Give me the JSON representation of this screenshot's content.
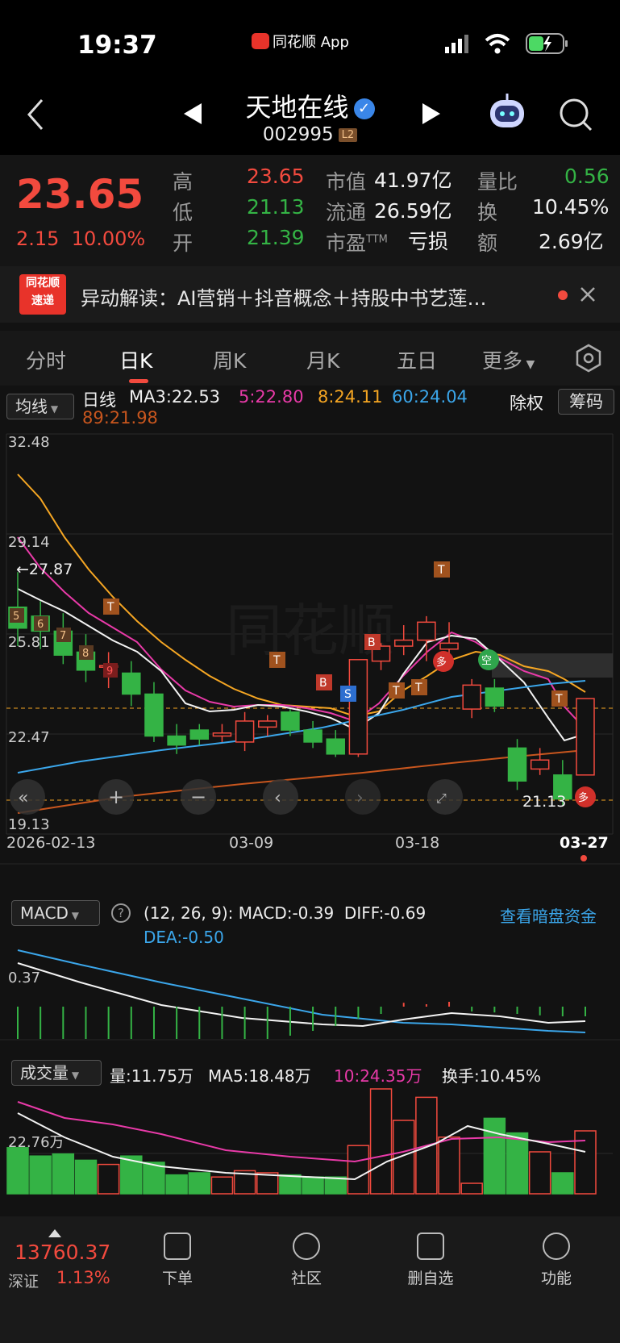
{
  "status": {
    "time": "19:37",
    "app": "同花顺 App"
  },
  "nav": {
    "name": "天地在线",
    "verified": "✓",
    "code": "002995",
    "level": "L2"
  },
  "quote": {
    "price": "23.65",
    "change": "2.15",
    "pct": "10.00%",
    "high_label": "高",
    "high": "23.65",
    "low_label": "低",
    "low": "21.13",
    "open_label": "开",
    "open": "21.39",
    "mcap_label": "市值",
    "mcap": "41.97亿",
    "float_label": "流通",
    "float": "26.59亿",
    "pe_label": "市盈",
    "pe_sup": "TTM",
    "pe": "亏损",
    "vr_label": "量比",
    "vr": "0.56",
    "turn_label": "换",
    "turn": "10.45%",
    "amt_label": "额",
    "amt": "2.69亿"
  },
  "news": {
    "logo_top": "同花顺",
    "logo_bottom": "速递",
    "text": "异动解读：AI营销＋抖音概念＋持股中书艺莲…"
  },
  "tabs": [
    "分时",
    "日K",
    "周K",
    "月K",
    "五日",
    "更多"
  ],
  "kline": {
    "indicator_btn": "均线",
    "ma_title": "日线",
    "ma3": "MA3:22.53",
    "ma5": "5:22.80",
    "ma8": "8:24.11",
    "ma60": "60:24.04",
    "ma89": "89:21.98",
    "fq_btn": "除权",
    "chip_btn": "筹码",
    "y_labels": [
      "32.48",
      "29.14",
      "25.81",
      "22.47",
      "19.13"
    ],
    "max_mark": "←27.87",
    "min_mark": "21.13",
    "dates": [
      "2026-02-13",
      "03-09",
      "03-18",
      "03-27"
    ],
    "duo": "多",
    "kong": "空"
  },
  "chart_data": {
    "type": "candlestick",
    "ylim": [
      19.13,
      32.48
    ],
    "candles": [
      {
        "o": 26.7,
        "c": 26.0,
        "h": 27.87,
        "l": 25.4
      },
      {
        "o": 26.4,
        "c": 25.9,
        "h": 26.9,
        "l": 25.3
      },
      {
        "o": 25.9,
        "c": 25.1,
        "h": 26.5,
        "l": 24.8
      },
      {
        "o": 25.2,
        "c": 24.6,
        "h": 25.8,
        "l": 24.2
      },
      {
        "o": 24.7,
        "c": 24.75,
        "h": 25.2,
        "l": 24.0
      },
      {
        "o": 24.5,
        "c": 23.8,
        "h": 24.9,
        "l": 23.4
      },
      {
        "o": 23.8,
        "c": 22.4,
        "h": 24.2,
        "l": 22.2
      },
      {
        "o": 22.4,
        "c": 22.1,
        "h": 22.8,
        "l": 21.8
      },
      {
        "o": 22.6,
        "c": 22.3,
        "h": 22.8,
        "l": 22.1
      },
      {
        "o": 22.4,
        "c": 22.5,
        "h": 22.8,
        "l": 22.2
      },
      {
        "o": 22.2,
        "c": 22.9,
        "h": 23.2,
        "l": 21.9
      },
      {
        "o": 22.7,
        "c": 22.9,
        "h": 23.1,
        "l": 22.4
      },
      {
        "o": 23.2,
        "c": 22.6,
        "h": 23.3,
        "l": 22.4
      },
      {
        "o": 22.6,
        "c": 22.2,
        "h": 22.9,
        "l": 22.0
      },
      {
        "o": 22.3,
        "c": 21.8,
        "h": 22.6,
        "l": 21.7
      },
      {
        "o": 21.8,
        "c": 24.95,
        "h": 24.95,
        "l": 21.7
      },
      {
        "o": 24.9,
        "c": 25.4,
        "h": 25.5,
        "l": 24.6
      },
      {
        "o": 25.4,
        "c": 25.6,
        "h": 26.1,
        "l": 25.1
      },
      {
        "o": 25.6,
        "c": 26.2,
        "h": 26.4,
        "l": 24.9
      },
      {
        "o": 25.3,
        "c": 25.5,
        "h": 26.2,
        "l": 24.9
      },
      {
        "o": 23.3,
        "c": 24.1,
        "h": 24.3,
        "l": 23.0
      },
      {
        "o": 24.0,
        "c": 23.4,
        "h": 24.3,
        "l": 23.2
      },
      {
        "o": 22.0,
        "c": 20.9,
        "h": 22.3,
        "l": 20.6
      },
      {
        "o": 21.3,
        "c": 21.6,
        "h": 22.0,
        "l": 21.1
      },
      {
        "o": 21.1,
        "c": 20.3,
        "h": 21.6,
        "l": 20.1
      },
      {
        "o": 21.1,
        "c": 23.65,
        "h": 23.65,
        "l": 21.13
      }
    ],
    "macd": {
      "title": "MACD",
      "params": "(12, 26, 9):",
      "macd": "MACD:-0.39",
      "diff": "DIFF:-0.69",
      "dea": "DEA:-0.50",
      "ylabel": "0.37",
      "link": "查看暗盘资金"
    },
    "volume": {
      "title": "成交量",
      "vol": "量:11.75万",
      "ma5": "MA5:18.48万",
      "ma10": "10:24.35万",
      "turn": "换手:10.45%",
      "ylabel": "22.76万",
      "bars": [
        22,
        18,
        19,
        16,
        14,
        18,
        15,
        9,
        10,
        8,
        11,
        10,
        9,
        8,
        8,
        23,
        50,
        35,
        46,
        27,
        5,
        36,
        29,
        20,
        10,
        30
      ]
    }
  },
  "bottom": {
    "index_value": "13760.37",
    "index_name": "深证",
    "index_pct": "1.13%",
    "items": [
      "下单",
      "社区",
      "删自选",
      "功能"
    ]
  }
}
